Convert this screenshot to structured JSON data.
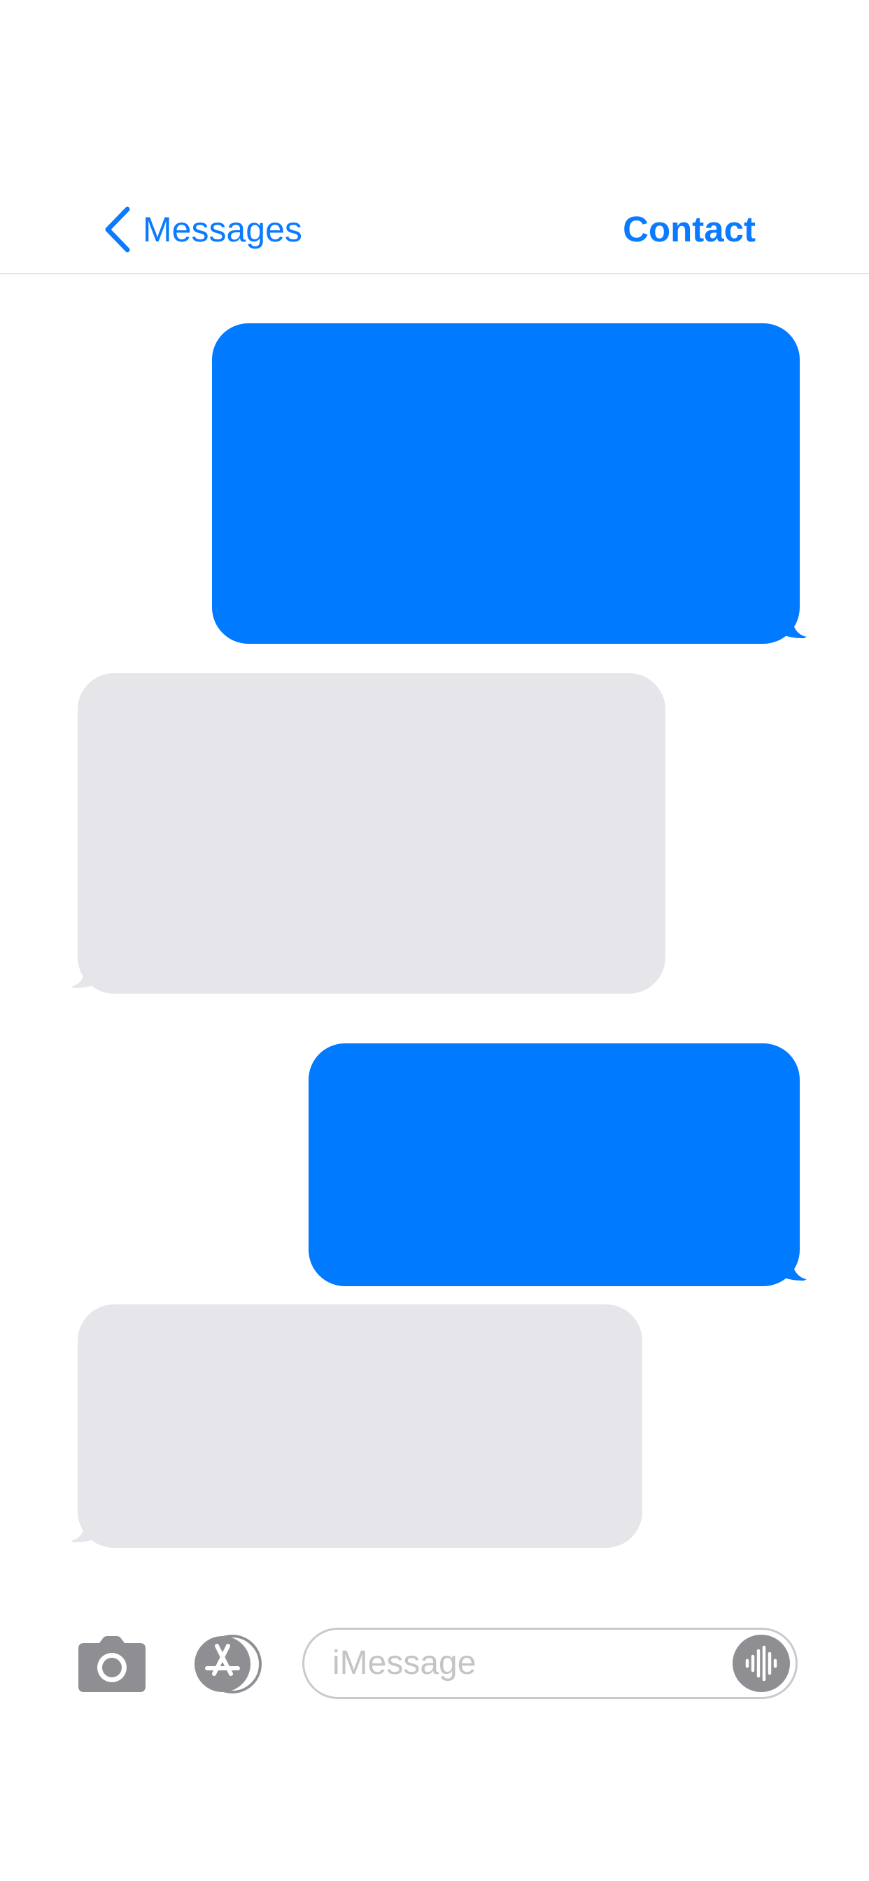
{
  "nav": {
    "back_label": "Messages",
    "contact_name": "Contact"
  },
  "thread": {
    "messages": [
      {
        "direction": "sent",
        "text": ""
      },
      {
        "direction": "received",
        "text": ""
      },
      {
        "direction": "sent",
        "text": ""
      },
      {
        "direction": "received",
        "text": ""
      }
    ]
  },
  "composer": {
    "placeholder": "iMessage",
    "camera_icon": "camera-icon",
    "apps_icon": "app-store-icon",
    "audio_icon": "waveform-icon"
  },
  "colors": {
    "accent": "#0a7aff",
    "sent_bubble": "#007aff",
    "received_bubble": "#e5e5ea",
    "icon_gray": "#8e8e93",
    "divider": "#e4e4e6"
  }
}
